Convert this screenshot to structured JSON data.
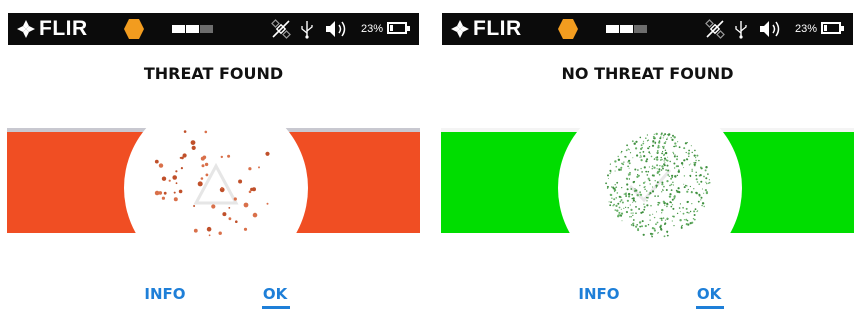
{
  "colors": {
    "threat": "#f04e23",
    "threat_top_edge": "#c8c8d0",
    "clear": "#00dd00",
    "clear_top_edge": "#f4f4f4",
    "accent": "#1e7fd8",
    "statusbar_bg": "#0b0b0b",
    "hex_icon": "#f29c1f"
  },
  "status_bar": {
    "brand": "FLIR",
    "battery_percent": "23%",
    "battery_level": 0.23,
    "signal_bars_filled": 2,
    "signal_bars_total": 3,
    "icons": [
      "flir-logo-icon",
      "hexagon-icon",
      "signal-strength-icon",
      "satellite-off-icon",
      "usb-icon",
      "volume-icon",
      "battery-icon"
    ]
  },
  "screens": [
    {
      "id": "threat",
      "title": "THREAT FOUND",
      "band_color": "#f04e23",
      "center_graphic": "warning-triangle-icon",
      "buttons": {
        "info": "INFO",
        "ok": "OK"
      }
    },
    {
      "id": "clear",
      "title": "NO THREAT FOUND",
      "band_color": "#00dd00",
      "center_graphic": "checkmark-icon",
      "buttons": {
        "info": "INFO",
        "ok": "OK"
      }
    }
  ]
}
